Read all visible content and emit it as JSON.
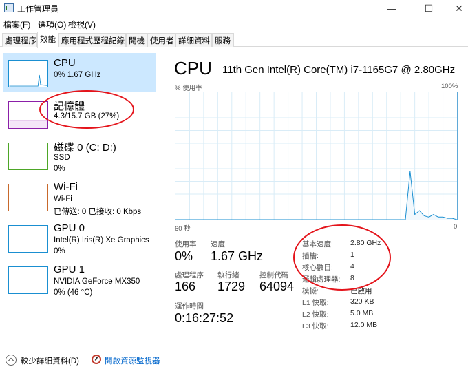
{
  "window": {
    "title": "工作管理員",
    "min": "—",
    "max": "☐",
    "close": "✕"
  },
  "menu": [
    "檔案(F)",
    "選項(O)",
    "檢視(V)"
  ],
  "tabs": [
    "處理程序",
    "效能",
    "應用程式歷程記錄",
    "開機",
    "使用者",
    "詳細資料",
    "服務"
  ],
  "sidebar": {
    "items": [
      {
        "name": "CPU",
        "sub1": "0% 1.67 GHz",
        "sub2": "",
        "color": "#1a8fd1"
      },
      {
        "name": "記憶體",
        "sub1": "4.3/15.7 GB (27%)",
        "sub2": "",
        "color": "#8b1fa8"
      },
      {
        "name": "磁碟 0 (C: D:)",
        "sub1": "SSD",
        "sub2": "0%",
        "color": "#4da627"
      },
      {
        "name": "Wi-Fi",
        "sub1": "Wi-Fi",
        "sub2": "已傳送: 0 已接收: 0 Kbps",
        "color": "#c8692c"
      },
      {
        "name": "GPU 0",
        "sub1": "Intel(R) Iris(R) Xe Graphics",
        "sub2": "0%",
        "color": "#1a8fd1"
      },
      {
        "name": "GPU 1",
        "sub1": "NVIDIA GeForce MX350",
        "sub2": "0% (46 °C)",
        "color": "#1a8fd1"
      }
    ]
  },
  "cpu": {
    "title": "CPU",
    "model": "11th Gen Intel(R) Core(TM) i7-1165G7 @ 2.80GHz",
    "graph_ylabel": "% 使用率",
    "graph_max": "100%",
    "graph_xlabel": "60 秒",
    "graph_xmax": "0",
    "line_color": "#1a8fd1"
  },
  "chart_data": {
    "type": "line",
    "x": [
      60,
      40,
      20,
      12,
      11,
      10,
      9,
      8,
      7,
      6,
      5,
      4,
      3,
      2,
      1,
      0
    ],
    "values": [
      0,
      0,
      0,
      0,
      0,
      38,
      4,
      7,
      3,
      2,
      4,
      2,
      2,
      1,
      1,
      0
    ],
    "ylim": [
      0,
      100
    ],
    "xlabel": "60 秒",
    "grid": true
  },
  "stats": {
    "usage": {
      "label": "使用率",
      "value": "0%"
    },
    "speed": {
      "label": "速度",
      "value": "1.67 GHz"
    },
    "processes": {
      "label": "處理程序",
      "value": "166"
    },
    "threads": {
      "label": "執行緒",
      "value": "1729"
    },
    "handles": {
      "label": "控制代碼",
      "value": "64094"
    },
    "uptime": {
      "label": "運作時間",
      "value": "0:16:27:52"
    }
  },
  "info": [
    {
      "label": "基本速度:",
      "value": "2.80 GHz"
    },
    {
      "label": "插槽:",
      "value": "1"
    },
    {
      "label": "核心數目:",
      "value": "4"
    },
    {
      "label": "邏輯處理器:",
      "value": "8"
    },
    {
      "label": "模擬:",
      "value": "已啟用"
    },
    {
      "label": "L1 快取:",
      "value": "320 KB"
    },
    {
      "label": "L2 快取:",
      "value": "5.0 MB"
    },
    {
      "label": "L3 快取:",
      "value": "12.0 MB"
    }
  ],
  "footer": {
    "collapse": "較少詳細資料(D)",
    "monitor": "開啟資源監視器"
  }
}
